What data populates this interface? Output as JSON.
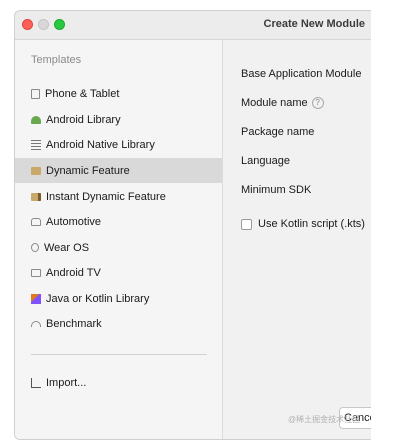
{
  "window": {
    "title": "Create New Module"
  },
  "sidebar": {
    "section_label": "Templates",
    "items": [
      {
        "label": "Phone & Tablet",
        "icon": "phone-tablet-icon",
        "selected": false
      },
      {
        "label": "Android Library",
        "icon": "android-icon",
        "selected": false
      },
      {
        "label": "Android Native Library",
        "icon": "native-library-icon",
        "selected": false
      },
      {
        "label": "Dynamic Feature",
        "icon": "dynamic-feature-icon",
        "selected": true
      },
      {
        "label": "Instant Dynamic Feature",
        "icon": "instant-feature-icon",
        "selected": false
      },
      {
        "label": "Automotive",
        "icon": "car-icon",
        "selected": false
      },
      {
        "label": "Wear OS",
        "icon": "watch-icon",
        "selected": false
      },
      {
        "label": "Android TV",
        "icon": "tv-icon",
        "selected": false
      },
      {
        "label": "Java or Kotlin Library",
        "icon": "kotlin-icon",
        "selected": false
      },
      {
        "label": "Benchmark",
        "icon": "benchmark-icon",
        "selected": false
      }
    ],
    "import_label": "Import..."
  },
  "form": {
    "heading": "Base Application Module",
    "module_name_label": "Module name",
    "module_name_help": "?",
    "package_name_label": "Package name",
    "language_label": "Language",
    "min_sdk_label": "Minimum SDK",
    "kotlin_script_label": "Use Kotlin script (.kts)",
    "kotlin_script_checked": false
  },
  "footer": {
    "cancel_label": "Cance"
  },
  "watermark": "@稀土掘金技术社区",
  "colors": {
    "selected_bg": "#d9d9d9",
    "sidebar_bg": "#f5f5f5"
  }
}
